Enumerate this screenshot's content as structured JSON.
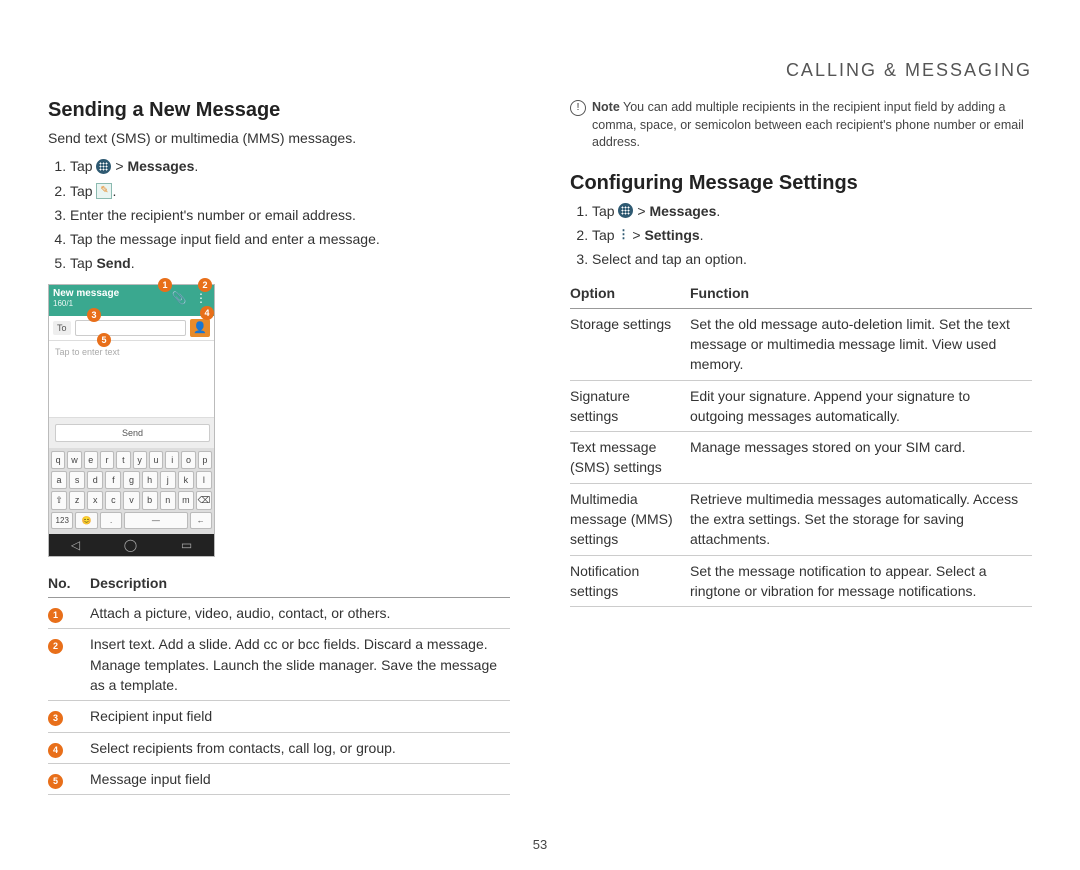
{
  "header": "CALLING & MESSAGING",
  "page_number": "53",
  "left": {
    "h2": "Sending a New Message",
    "intro": "Send text (SMS) or multimedia (MMS) messages.",
    "steps": [
      {
        "pre": "Tap ",
        "icon": "apps",
        "post": " > ",
        "bold": "Messages",
        "tail": "."
      },
      {
        "pre": "Tap ",
        "icon": "compose",
        "post": ".",
        "bold": "",
        "tail": ""
      },
      {
        "pre": "Enter the recipient's number or email address.",
        "icon": "",
        "post": "",
        "bold": "",
        "tail": ""
      },
      {
        "pre": "Tap the message input field and enter a message.",
        "icon": "",
        "post": "",
        "bold": "",
        "tail": ""
      },
      {
        "pre": "Tap ",
        "icon": "",
        "post": "",
        "bold": "Send",
        "tail": "."
      }
    ],
    "phone": {
      "title": "New message",
      "count": "160/1",
      "to_label": "To",
      "placeholder": "Tap to enter text",
      "send": "Send",
      "kbd_rows": [
        [
          "q",
          "w",
          "e",
          "r",
          "t",
          "y",
          "u",
          "i",
          "o",
          "p"
        ],
        [
          "a",
          "s",
          "d",
          "f",
          "g",
          "h",
          "j",
          "k",
          "l"
        ],
        [
          "⇧",
          "z",
          "x",
          "c",
          "v",
          "b",
          "n",
          "m",
          "⌫"
        ],
        [
          "123",
          "😊",
          ".",
          "—",
          "←"
        ]
      ],
      "callouts": [
        "1",
        "2",
        "3",
        "4",
        "5"
      ]
    },
    "desc_header": {
      "no": "No.",
      "desc": "Description"
    },
    "desc": [
      "Attach a picture, video, audio, contact, or others.",
      "Insert text. Add a slide. Add cc or bcc fields. Discard a message. Manage templates. Launch the slide manager. Save the message as a template.",
      "Recipient input field",
      "Select recipients from contacts, call log, or group.",
      "Message input field"
    ]
  },
  "right": {
    "note_label": "Note",
    "note_text": " You can add multiple recipients in the recipient input field by adding a comma, space, or semicolon between each recipient's phone number or email address.",
    "h2": "Configuring Message Settings",
    "steps": [
      {
        "pre": "Tap ",
        "icon": "apps",
        "post": " > ",
        "bold": "Messages",
        "tail": "."
      },
      {
        "pre": "Tap ",
        "icon": "menu",
        "post": " > ",
        "bold": "Settings",
        "tail": "."
      },
      {
        "pre": "Select and tap an option.",
        "icon": "",
        "post": "",
        "bold": "",
        "tail": ""
      }
    ],
    "table_header": {
      "option": "Option",
      "function": "Function"
    },
    "table": [
      {
        "opt": "Storage settings",
        "fn": "Set the old message auto-deletion limit. Set the text message or multimedia message limit. View used memory."
      },
      {
        "opt": "Signature settings",
        "fn": "Edit your signature. Append your signature to outgoing messages automatically."
      },
      {
        "opt": "Text message (SMS) settings",
        "fn": "Manage messages stored on your SIM card."
      },
      {
        "opt": "Multimedia message (MMS) settings",
        "fn": "Retrieve multimedia messages automatically. Access the extra settings. Set the storage for saving attachments."
      },
      {
        "opt": "Notification settings",
        "fn": "Set the message notification to appear. Select a ringtone or vibration for message notifications."
      }
    ]
  }
}
